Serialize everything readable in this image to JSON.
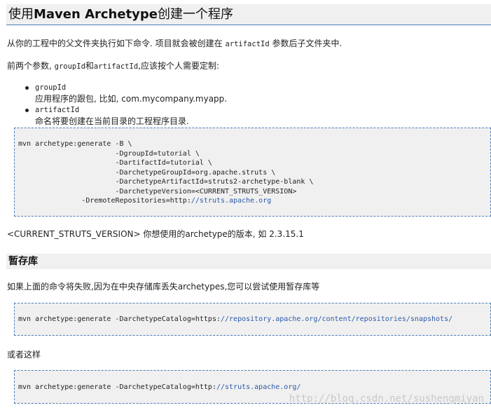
{
  "title": {
    "pre": "使用",
    "bold": "Maven Archetype",
    "post": "创建一个程序"
  },
  "intro": {
    "a": "从你的工程中的父文件夹执行如下命令. 项目就会被创建在 ",
    "code": "artifactId",
    "b": " 参数后子文件夹中."
  },
  "params_line": {
    "a": "前两个参数, ",
    "c1": "groupId",
    "mid": "和",
    "c2": "artifactId",
    "b": ",应该按个人需要定制:"
  },
  "bullets": [
    {
      "term": "groupId",
      "desc": "应用程序的跟包, 比如, com.mycompany.myapp."
    },
    {
      "term": "artifactId",
      "desc": "命名将要创建在当前目录的工程程序目录."
    }
  ],
  "code1": {
    "lines": [
      "mvn archetype:generate -B \\",
      "                       -DgroupId=tutorial \\",
      "                       -DartifactId=tutorial \\",
      "                       -DarchetypeGroupId=org.apache.struts \\",
      "                       -DarchetypeArtifactId=struts2-archetype-blank \\",
      "                       -DarchetypeVersion=<CURRENT_STRUTS_VERSION>"
    ],
    "last_prefix": "               -DremoteRepositories=http:",
    "last_url": "//struts.apache.org"
  },
  "version_note": "<CURRENT_STRUTS_VERSION> 你想使用的archetype的版本, 如 2.3.15.1",
  "section2_title": "暂存库",
  "fail_text": "如果上面的命令将失败,因为在中央存储库丢失archetypes,您可以尝试使用暂存库等",
  "code2": {
    "prefix": "mvn archetype:generate -DarchetypeCatalog=https:",
    "url": "//repository.apache.org/content/repositories/snapshots/"
  },
  "or_text": "或者这样",
  "code3": {
    "prefix": "mvn archetype:generate -DarchetypeCatalog=http:",
    "url": "//struts.apache.org/"
  },
  "watermark": "http://blog.csdn.net/sushengmiyan"
}
